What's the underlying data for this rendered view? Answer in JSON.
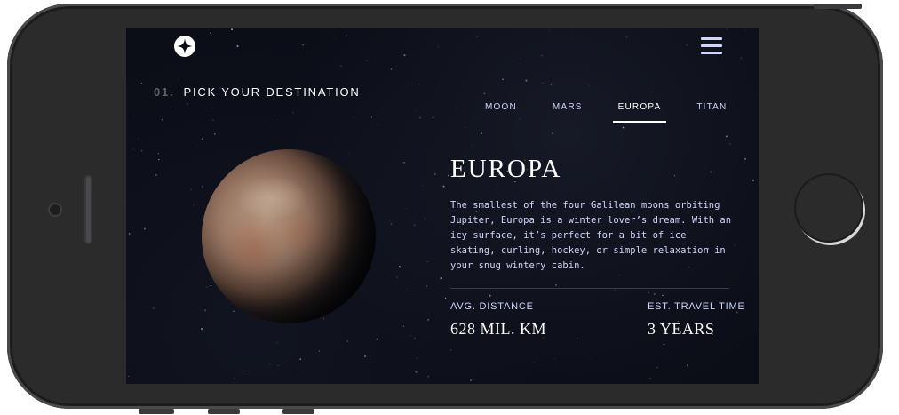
{
  "header": {
    "logo_icon": "star-logo-icon",
    "menu_icon": "hamburger-menu-icon"
  },
  "step": {
    "number": "01.",
    "title": "PICK YOUR DESTINATION"
  },
  "tabs": [
    {
      "label": "MOON",
      "active": false
    },
    {
      "label": "MARS",
      "active": false
    },
    {
      "label": "EUROPA",
      "active": true
    },
    {
      "label": "TITAN",
      "active": false
    }
  ],
  "destination": {
    "name": "EUROPA",
    "description": "The smallest of the four Galilean moons orbiting Jupiter, Europa is a winter lover’s dream. With an icy surface, it’s perfect for a bit of ice skating, curling, hockey, or simple relaxation in your snug wintery cabin.",
    "distance_label": "AVG. DISTANCE",
    "distance_value": "628 MIL. KM",
    "travel_label": "EST. TRAVEL TIME",
    "travel_value": "3 YEARS"
  },
  "colors": {
    "background": "#0b0d17",
    "accent_text": "#d0d6f9",
    "white": "#ffffff"
  }
}
